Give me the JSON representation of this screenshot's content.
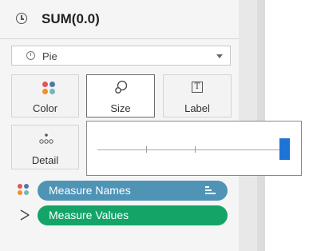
{
  "header": {
    "title": "SUM(0.0)",
    "icon": "clock-icon"
  },
  "mark_type": {
    "selected": "Pie",
    "icon": "pie-icon"
  },
  "marks": {
    "color_label": "Color",
    "size_label": "Size",
    "label_label": "Label",
    "label_icon_text": "T",
    "detail_label": "Detail"
  },
  "size_slider": {
    "value": 1.0
  },
  "fields": [
    {
      "label": "Measure Names",
      "color": "#4f94b5"
    },
    {
      "label": "Measure Values",
      "color": "#14a468"
    }
  ]
}
